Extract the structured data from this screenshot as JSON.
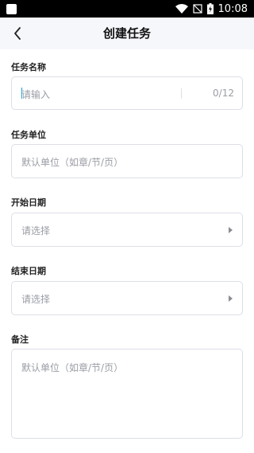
{
  "status_bar": {
    "time": "10:08",
    "icons": [
      "notification-square-icon",
      "wifi-icon",
      "no-signal-icon",
      "battery-charging-icon"
    ]
  },
  "header": {
    "title": "创建任务",
    "back_icon": "chevron-left-icon"
  },
  "form": {
    "task_name": {
      "label": "任务名称",
      "placeholder": "请输入",
      "counter": "0/12"
    },
    "task_unit": {
      "label": "任务单位",
      "placeholder": "默认单位（如章/节/页）"
    },
    "start_date": {
      "label": "开始日期",
      "placeholder": "请选择"
    },
    "end_date": {
      "label": "结束日期",
      "placeholder": "请选择"
    },
    "remark": {
      "label": "备注",
      "placeholder": "默认单位（如章/节/页）"
    }
  },
  "colors": {
    "accent_caret": "#18a1d6",
    "header_bg": "#f6f7fb",
    "border": "#dcdfe6",
    "placeholder": "#9a9da4"
  }
}
